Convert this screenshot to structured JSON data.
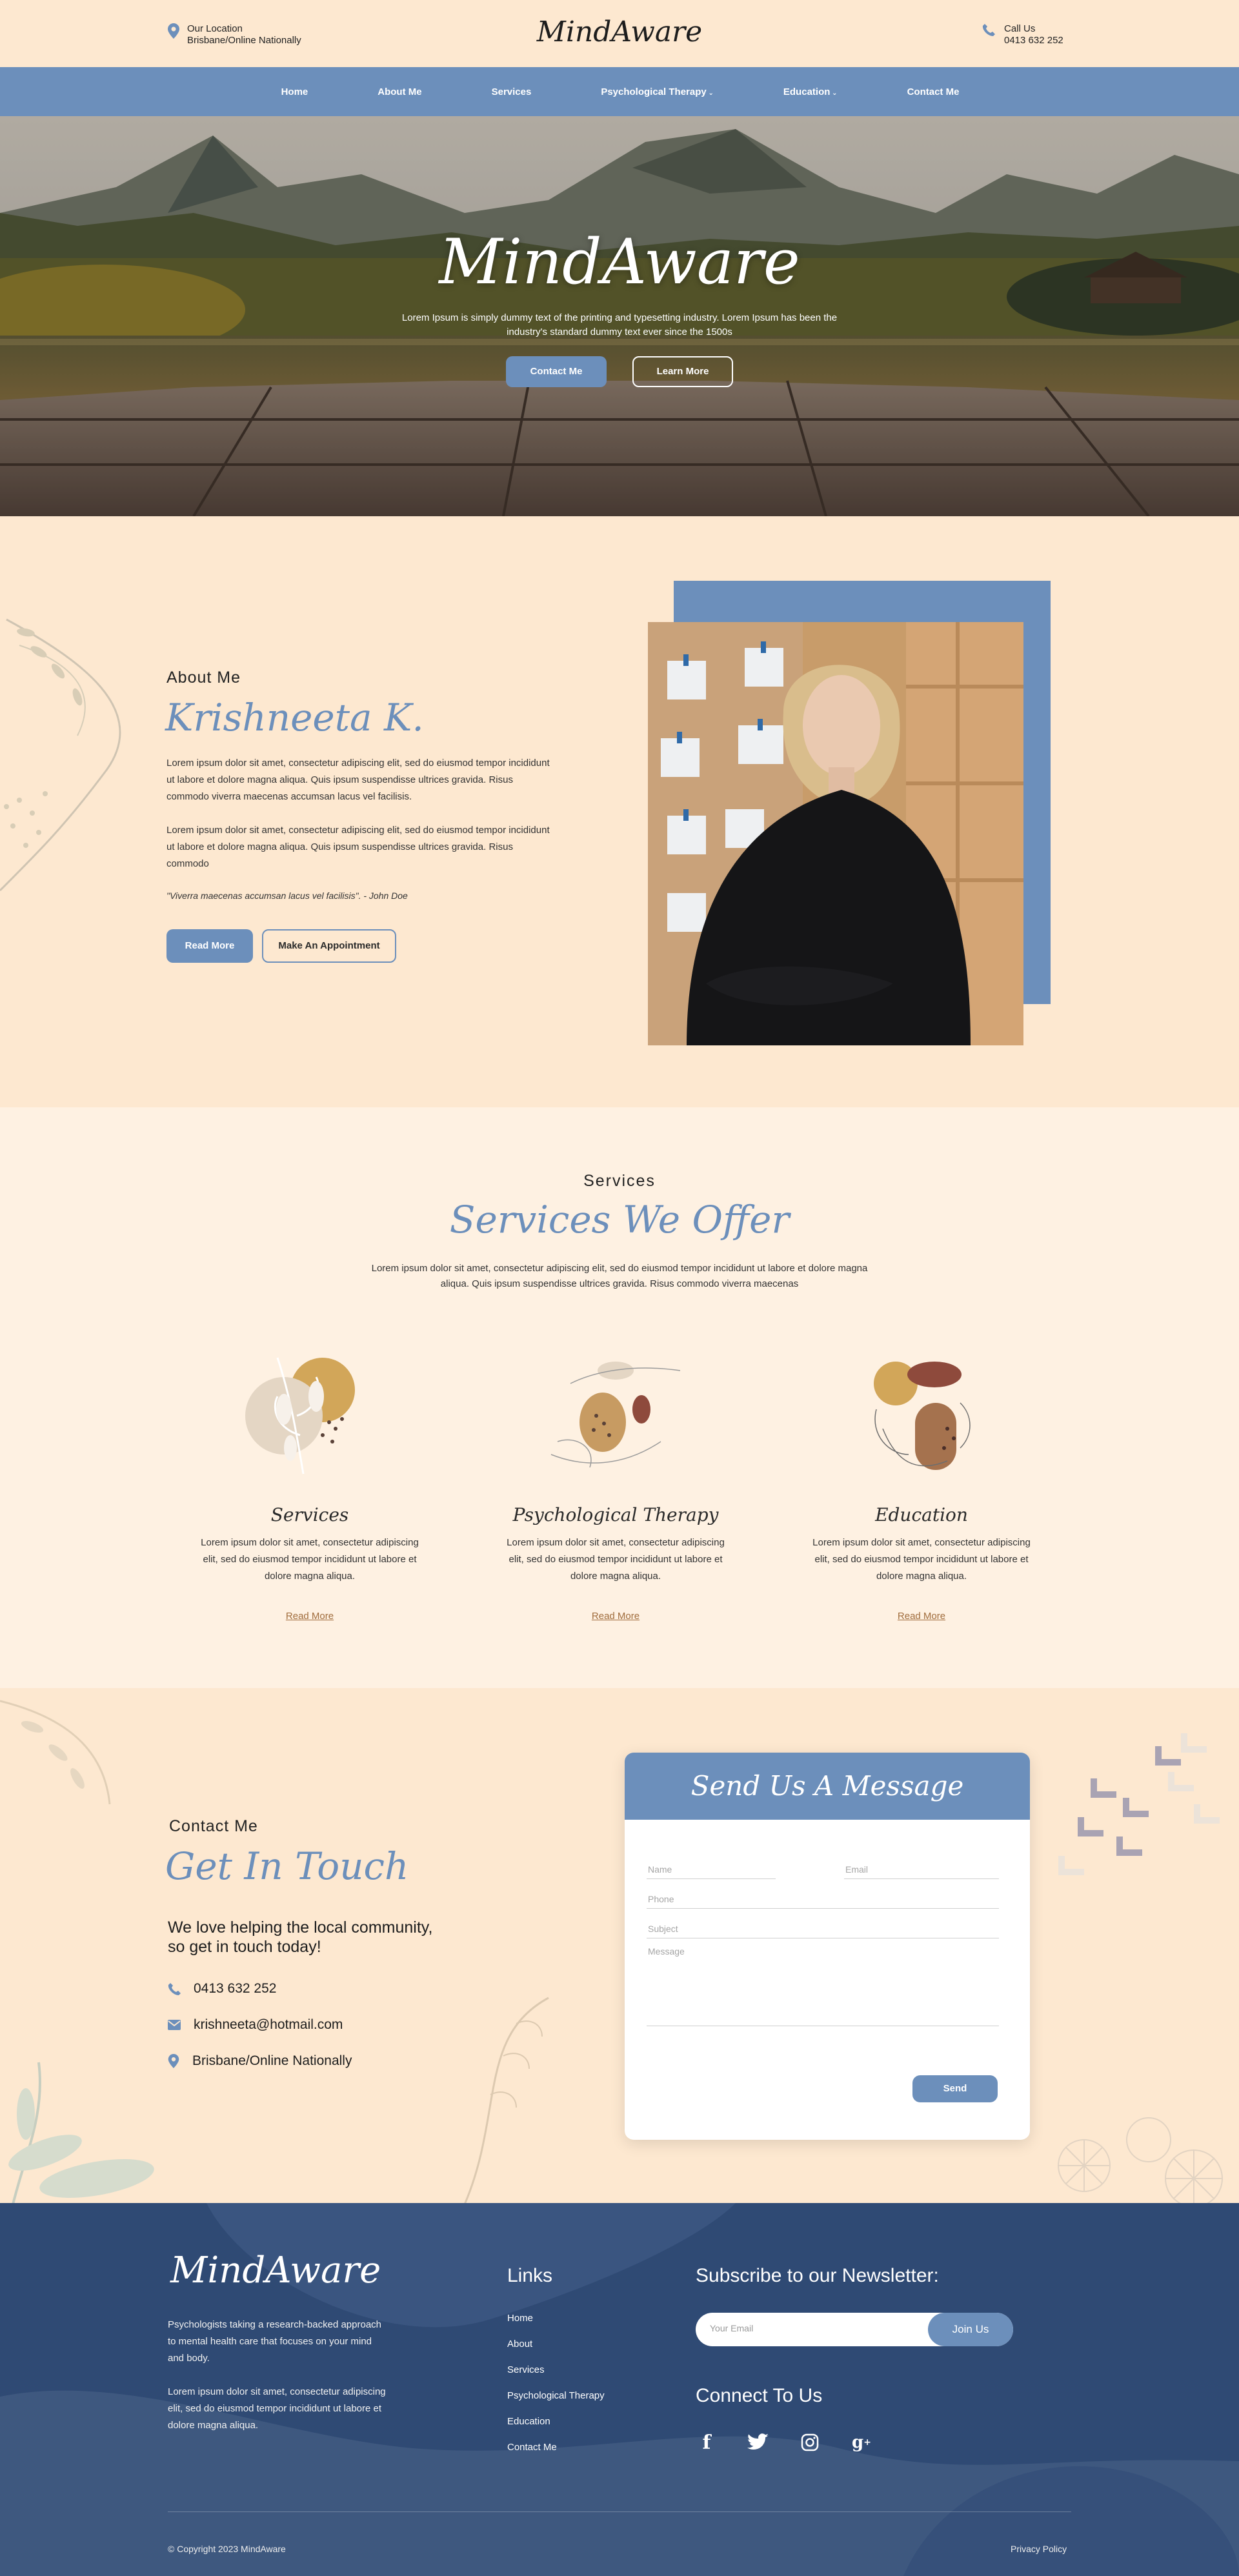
{
  "header": {
    "location_label": "Our Location",
    "location_value": "Brisbane/Online Nationally",
    "logo": "MindAware",
    "call_label": "Call Us",
    "call_value": "0413 632 252"
  },
  "nav": {
    "items": [
      "Home",
      "About Me",
      "Services",
      "Psychological Therapy",
      "Education",
      "Contact Me"
    ]
  },
  "hero": {
    "title": "MindAware",
    "subtitle": "Lorem Ipsum is simply dummy text of the printing and typesetting industry. Lorem Ipsum has been the industry's standard dummy text ever since the 1500s",
    "contact_button": "Contact Me",
    "learn_button": "Learn More"
  },
  "about": {
    "eyebrow": "About Me",
    "name": "Krishneeta K.",
    "para1": "Lorem ipsum dolor sit amet, consectetur adipiscing elit, sed do eiusmod tempor incididunt ut labore et dolore magna aliqua. Quis ipsum suspendisse ultrices gravida. Risus commodo viverra maecenas accumsan lacus vel facilisis.",
    "para2": "Lorem ipsum dolor sit amet, consectetur adipiscing elit, sed do eiusmod tempor incididunt ut labore et dolore magna aliqua. Quis ipsum suspendisse ultrices gravida. Risus commodo",
    "quote": "\"Viverra maecenas accumsan lacus vel facilisis\". - John Doe",
    "read_more": "Read More",
    "appointment": "Make An Appointment"
  },
  "services": {
    "eyebrow": "Services",
    "heading": "Services We Offer",
    "intro": "Lorem ipsum dolor sit amet, consectetur adipiscing elit, sed do eiusmod tempor incididunt ut labore et dolore magna aliqua. Quis ipsum suspendisse ultrices gravida. Risus commodo viverra maecenas",
    "cards": [
      {
        "title": "Services",
        "text": "Lorem ipsum dolor sit amet, consectetur adipiscing elit, sed do eiusmod tempor incididunt ut labore et dolore magna aliqua.",
        "link": "Read More"
      },
      {
        "title": "Psychological Therapy",
        "text": "Lorem ipsum dolor sit amet, consectetur adipiscing elit, sed do eiusmod tempor incididunt ut labore et dolore magna aliqua.",
        "link": "Read More"
      },
      {
        "title": "Education",
        "text": "Lorem ipsum dolor sit amet, consectetur adipiscing elit, sed do eiusmod tempor incididunt ut labore et dolore magna aliqua.",
        "link": "Read More"
      }
    ]
  },
  "contact": {
    "eyebrow": "Contact Me",
    "heading": "Get In Touch",
    "lead": "We love helping the local community, so get in touch today!",
    "phone": "0413 632 252",
    "email": "krishneeta@hotmail.com",
    "location": "Brisbane/Online Nationally",
    "form": {
      "title": "Send Us A Message",
      "name": "Name",
      "email": "Email",
      "phone": "Phone",
      "subject": "Subject",
      "message": "Message",
      "send": "Send"
    }
  },
  "footer": {
    "logo": "MindAware",
    "para1": "Psychologists taking a research-backed approach to mental health care that focuses on your mind and body.",
    "para2": "Lorem ipsum dolor sit amet, consectetur adipiscing elit, sed do eiusmod tempor incididunt ut labore et dolore magna aliqua.",
    "links_heading": "Links",
    "links": [
      "Home",
      "About",
      "Services",
      "Psychological Therapy",
      "Education",
      "Contact Me"
    ],
    "newsletter_heading": "Subscribe to our Newsletter:",
    "email_placeholder": "Your Email",
    "join": "Join Us",
    "connect_heading": "Connect To Us",
    "social": [
      "facebook-icon",
      "twitter-icon",
      "instagram-icon",
      "google-plus-icon"
    ],
    "copyright": "© Copyright 2023 MindAware",
    "privacy": "Privacy Policy"
  },
  "colors": {
    "accent": "#6c8fbb",
    "background": "#fde8d0",
    "footer": "#2f4a74",
    "link": "#a06c3c"
  }
}
